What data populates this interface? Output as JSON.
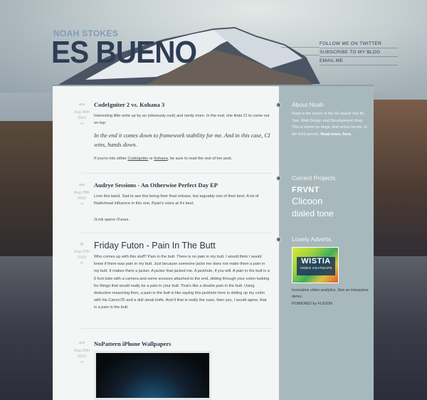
{
  "header": {
    "author": "NOAH STOKES",
    "site_title": "ES BUENO",
    "nav": [
      {
        "label": "FOLLOW ME ON TWITTER"
      },
      {
        "label": "SUBSCRIBE TO MY BLOG"
      },
      {
        "label": "EMAIL ME"
      }
    ]
  },
  "posts": [
    {
      "icon": "link-icon",
      "date": "Aug 30th",
      "year": "2010",
      "dash": "∞",
      "title": "CodeIgniter 2 vs. Kohana 3",
      "text1": "Interesting little write up by an (obviously cool) and nerdy mom. In the end, she finds CI to come out on top:",
      "quote": "In the end it comes down to framework stability for me.  And in this case, CI wins,  hands down.",
      "text2_prefix": "If you're into either ",
      "link1": "CodeIgniter",
      "text2_mid": " or ",
      "link2": "Kohana",
      "text2_suffix": ", be sure to read the rest of her post."
    },
    {
      "icon": "link-icon",
      "date": "Aug 28th",
      "year": "2010",
      "dash": "∞",
      "title": "Audrye Sessions - An Otherwise Perfect Day EP",
      "text1": "Love this band. Sad to see this being their final release, but arguably one of their best. A lot of Radiohead influence in this one, Ryan's voice at it's best.",
      "text2": "//Link opens iTunes."
    },
    {
      "icon": "text-icon",
      "date": "Aug 27th",
      "year": "2010",
      "dash": "∞",
      "title": "Friday Futon - Pain In The Butt",
      "text1": "Who comes up with this stuff? Pain in the butt. There is no pain in my butt. I would think I would know if there was pain in my butt. Just because someone jackx me does not make them a pain in my butt. It makes them a jacker. A jacker that jacked me. A jackhole, if you will. A pain in the butt is a 6 foot tube with a camera and some scissors attached to the end, sliding through your colon looking for things that would really be a pain in your butt. That's like a double pain in the butt. Using deductive reasoning then, a pain in the butt is like saying this jackhole here is sliding up my colon with his Canon7D and a dull steak knife. And if that is really the case, then yes, I would agree, that is a pain in the butt."
    },
    {
      "icon": "link-icon",
      "date": "Aug 26th",
      "year": "2010",
      "dash": "∞",
      "title": "NoPattern iPhone Wallpapers"
    }
  ],
  "sidebar": {
    "about": {
      "heading": "About Noah",
      "text": "Noah is the owner of the SF based Two By Two, Web Design and Development shop. This is where he blogs. And writes his bio. In the third person.",
      "link": "Read more, here."
    },
    "projects": {
      "heading": "Current Projects",
      "items": [
        "FRVNT",
        "Clicoon",
        "dialed tone"
      ]
    },
    "adverts": {
      "heading": "Lovely Adverts",
      "ad_title": "WISTIA",
      "ad_sub": "VIDEO HEATMAPS",
      "ad_text": "Innovative video analytics. See an interactive demo.",
      "powered": "POWERED by FUSION"
    }
  }
}
